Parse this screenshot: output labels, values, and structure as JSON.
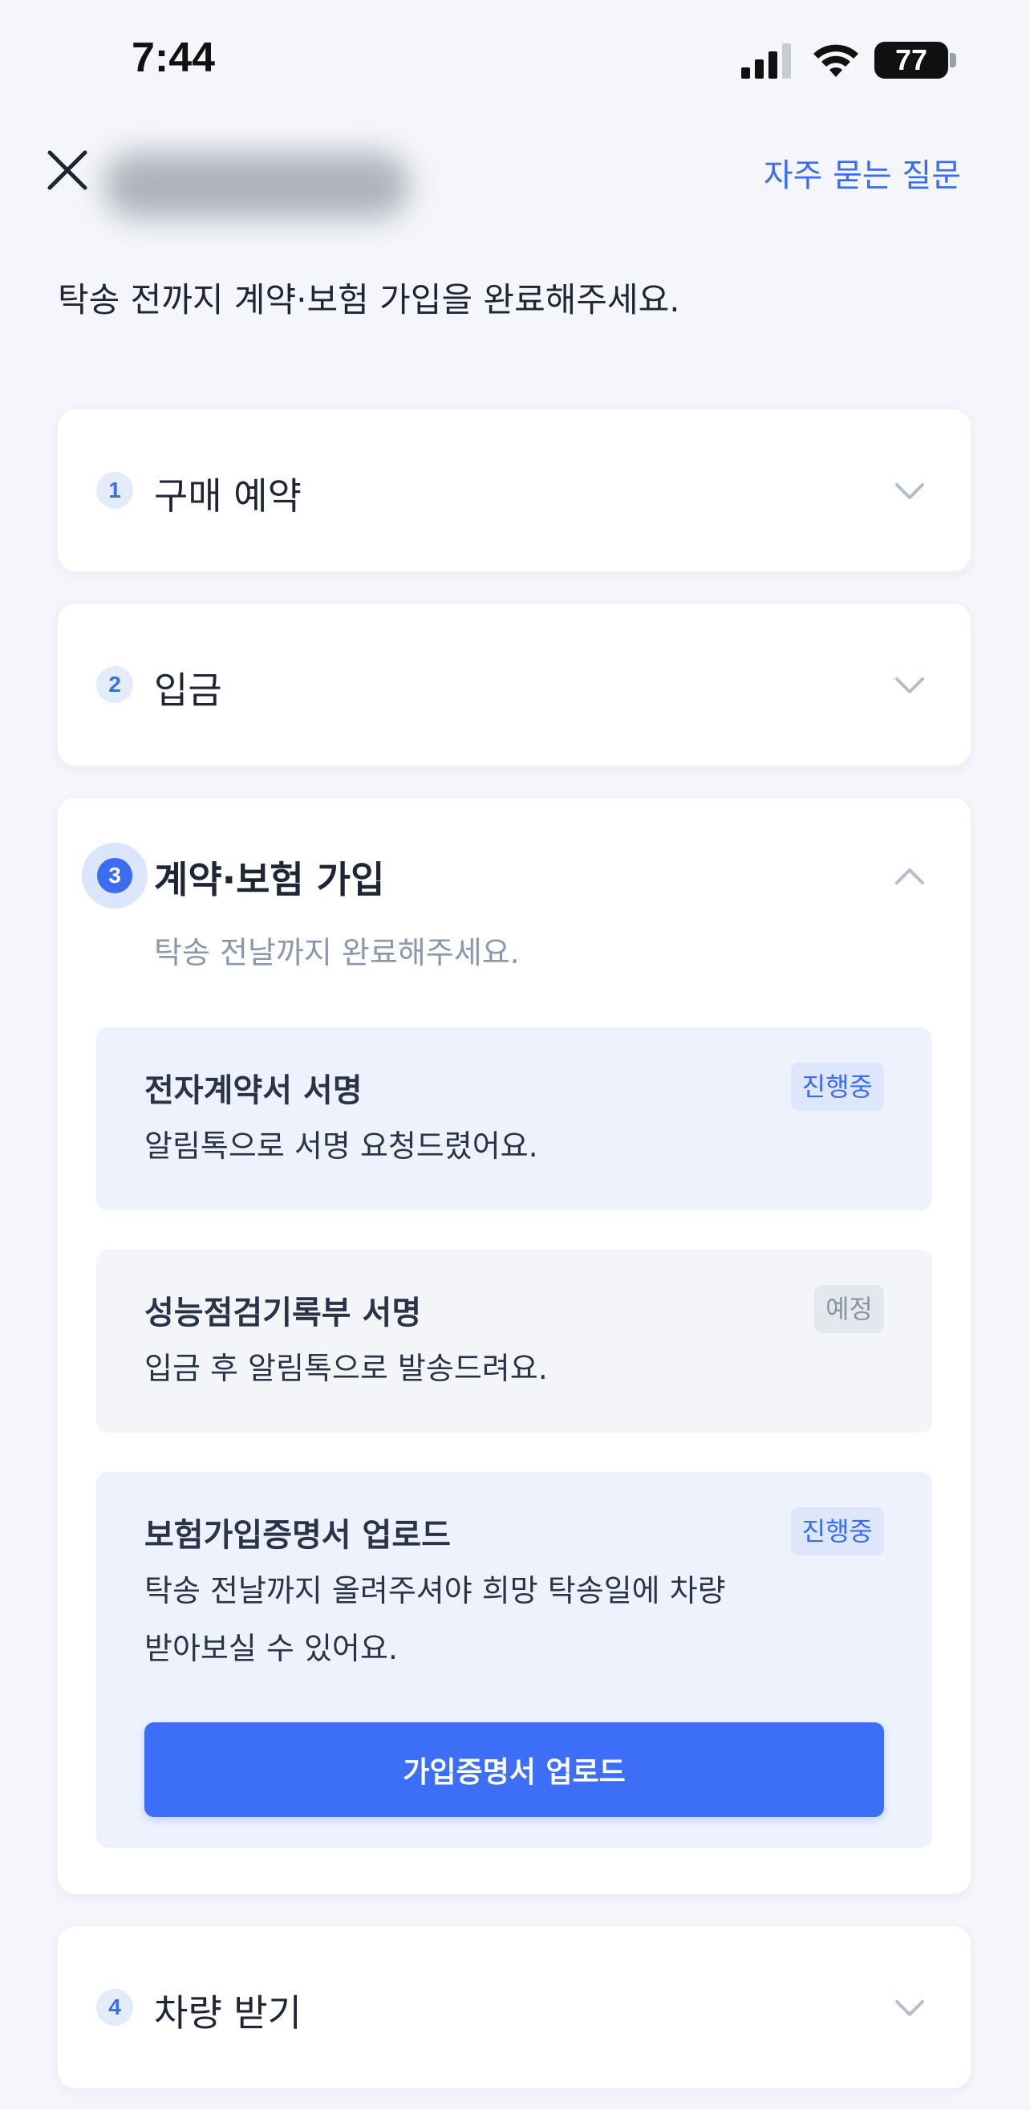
{
  "status_bar": {
    "time": "7:44",
    "battery": "77"
  },
  "nav": {
    "faq_label": "자주 묻는 질문"
  },
  "intro_text": "탁송 전까지 계약·보험 가입을 완료해주세요.",
  "steps": [
    {
      "number": "1",
      "title": "구매 예약"
    },
    {
      "number": "2",
      "title": "입금"
    },
    {
      "number": "3",
      "title": "계약·보험 가입",
      "subtitle": "탁송 전날까지 완료해주세요.",
      "tasks": [
        {
          "title": "전자계약서 서명",
          "status": "진행중",
          "desc": "알림톡으로 서명 요청드렸어요."
        },
        {
          "title": "성능점검기록부 서명",
          "status": "예정",
          "desc": "입금 후 알림톡으로 발송드려요."
        },
        {
          "title": "보험가입증명서 업로드",
          "status": "진행중",
          "desc_line1": "탁송 전날까지 올려주셔야 희망 탁송일에 차량",
          "desc_line2": "받아보실 수 있어요.",
          "button_label": "가입증명서 업로드"
        }
      ]
    },
    {
      "number": "4",
      "title": "차량 받기"
    }
  ],
  "colors": {
    "accent": "#3a6df0",
    "button": "#3d6ef7",
    "background": "#f4f6fb"
  }
}
